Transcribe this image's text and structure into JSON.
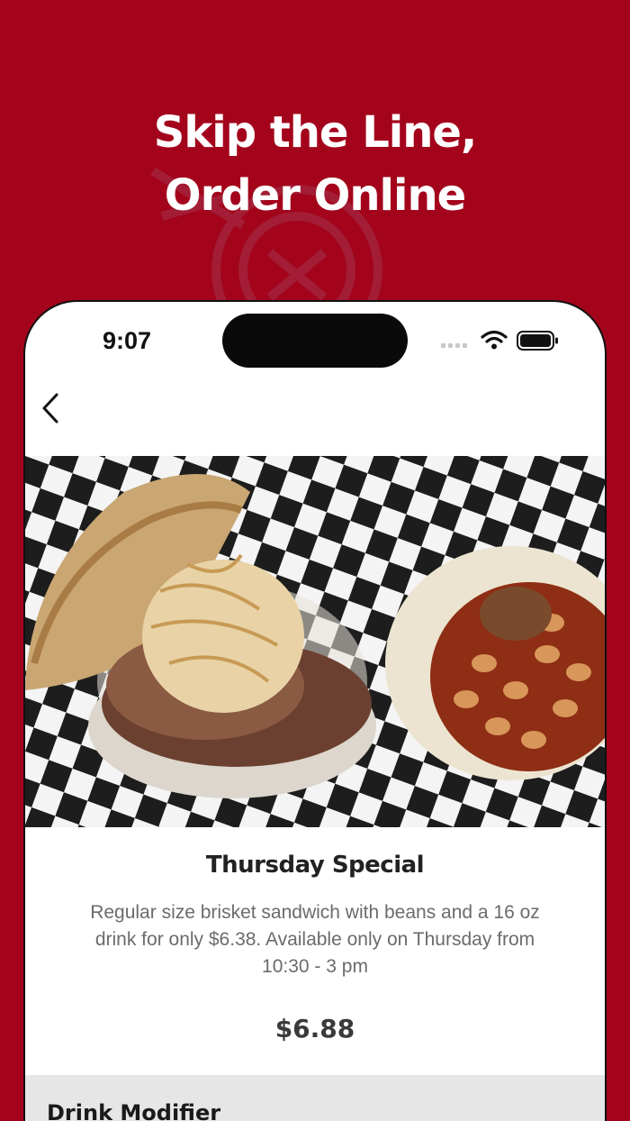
{
  "headline": {
    "line1": "Skip the Line,",
    "line2": "Order Online"
  },
  "status_bar": {
    "time": "9:07",
    "icons": [
      "signal-dots-icon",
      "wifi-icon",
      "battery-icon"
    ]
  },
  "nav": {
    "back_icon": "chevron-left-icon"
  },
  "product": {
    "image": "brisket-sandwich-with-beans-photo",
    "title": "Thursday Special",
    "description": "Regular size brisket sandwich with beans and a 16 oz drink for only $6.38. Available only on Thursday from 10:30 - 3 pm",
    "price": "$6.88"
  },
  "modifier": {
    "title": "Drink Modifier"
  },
  "colors": {
    "brand_red": "#a3041b",
    "text_dark": "#222222",
    "text_muted": "#6b6b6b",
    "section_bg": "#e6e6e6"
  }
}
